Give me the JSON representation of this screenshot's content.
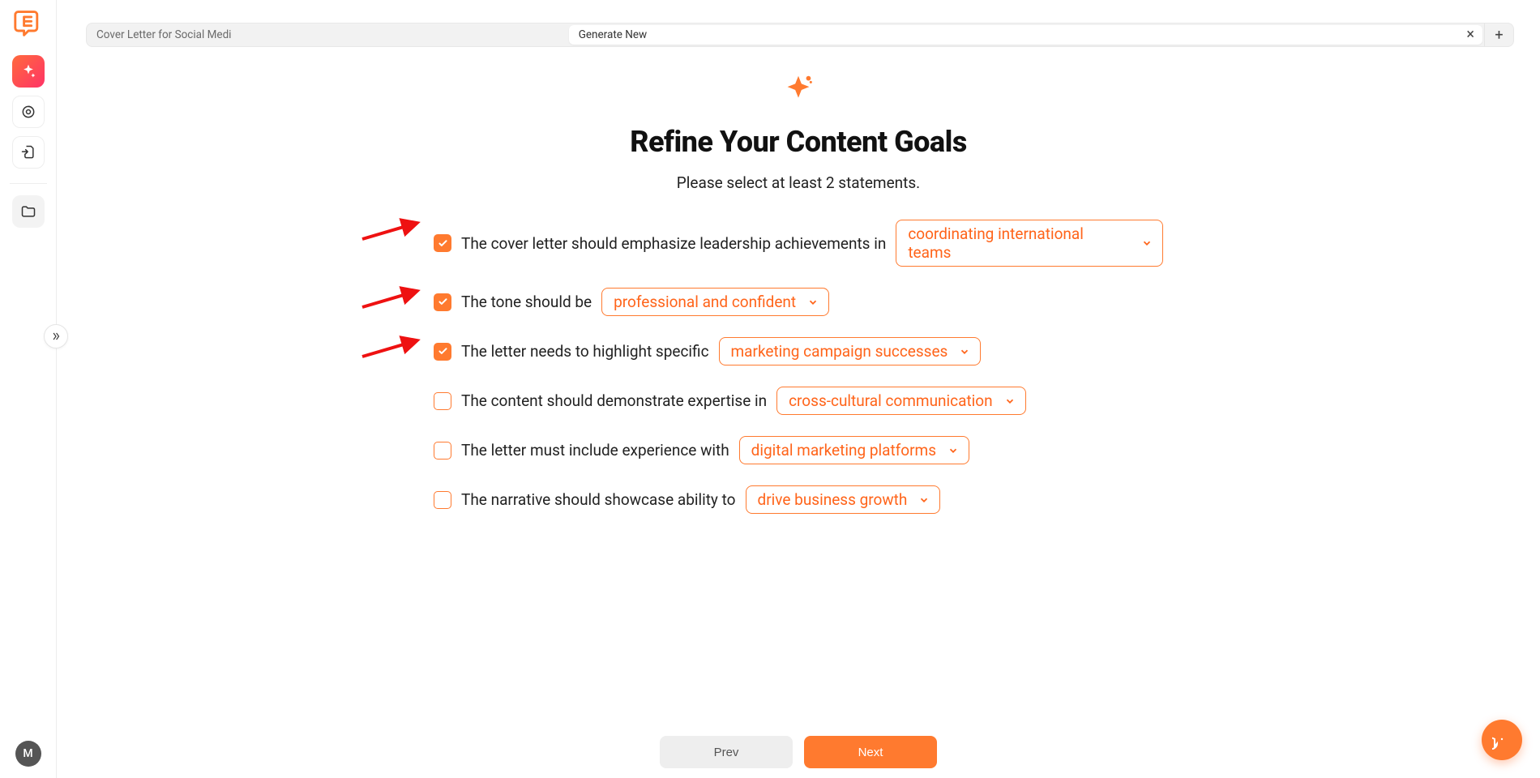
{
  "colors": {
    "accent": "#ff7a2f"
  },
  "sidebar": {
    "avatar_letter": "M"
  },
  "tabs": {
    "items": [
      {
        "label": "Cover Letter for Social Medi",
        "active": false
      },
      {
        "label": "Generate New",
        "active": true
      }
    ]
  },
  "header": {
    "title": "Refine Your Content Goals",
    "subtitle": "Please select at least 2 statements."
  },
  "statements": [
    {
      "checked": true,
      "text": "The cover letter should emphasize leadership achievements in",
      "option": "coordinating international teams",
      "arrow": true
    },
    {
      "checked": true,
      "text": "The tone should be",
      "option": "professional and confident",
      "arrow": true
    },
    {
      "checked": true,
      "text": "The letter needs to highlight specific",
      "option": "marketing campaign successes",
      "arrow": true
    },
    {
      "checked": false,
      "text": "The content should demonstrate expertise in",
      "option": "cross-cultural communication",
      "arrow": false
    },
    {
      "checked": false,
      "text": "The letter must include experience with",
      "option": "digital marketing platforms",
      "arrow": false
    },
    {
      "checked": false,
      "text": "The narrative should showcase ability to",
      "option": "drive business growth",
      "arrow": false
    }
  ],
  "footer": {
    "prev_label": "Prev",
    "next_label": "Next"
  }
}
